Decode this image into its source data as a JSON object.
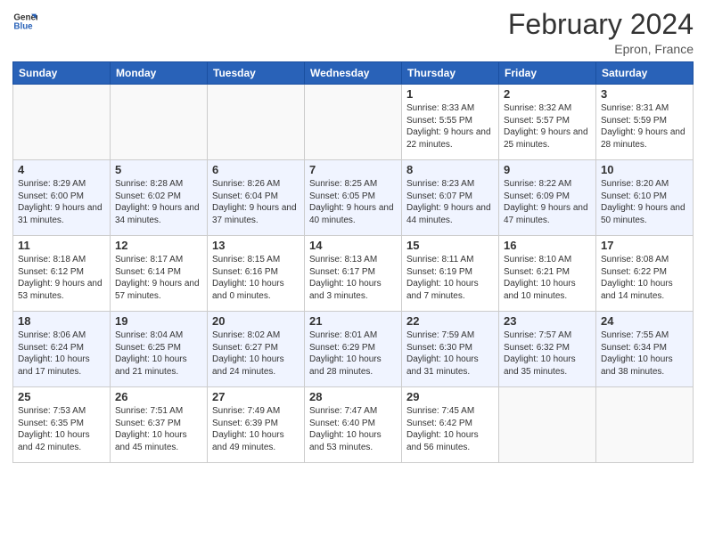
{
  "header": {
    "logo_line1": "General",
    "logo_line2": "Blue",
    "title": "February 2024",
    "subtitle": "Epron, France"
  },
  "days_of_week": [
    "Sunday",
    "Monday",
    "Tuesday",
    "Wednesday",
    "Thursday",
    "Friday",
    "Saturday"
  ],
  "weeks": [
    {
      "alt": false,
      "days": [
        {
          "num": "",
          "info": ""
        },
        {
          "num": "",
          "info": ""
        },
        {
          "num": "",
          "info": ""
        },
        {
          "num": "",
          "info": ""
        },
        {
          "num": "1",
          "info": "Sunrise: 8:33 AM\nSunset: 5:55 PM\nDaylight: 9 hours and 22 minutes."
        },
        {
          "num": "2",
          "info": "Sunrise: 8:32 AM\nSunset: 5:57 PM\nDaylight: 9 hours and 25 minutes."
        },
        {
          "num": "3",
          "info": "Sunrise: 8:31 AM\nSunset: 5:59 PM\nDaylight: 9 hours and 28 minutes."
        }
      ]
    },
    {
      "alt": true,
      "days": [
        {
          "num": "4",
          "info": "Sunrise: 8:29 AM\nSunset: 6:00 PM\nDaylight: 9 hours and 31 minutes."
        },
        {
          "num": "5",
          "info": "Sunrise: 8:28 AM\nSunset: 6:02 PM\nDaylight: 9 hours and 34 minutes."
        },
        {
          "num": "6",
          "info": "Sunrise: 8:26 AM\nSunset: 6:04 PM\nDaylight: 9 hours and 37 minutes."
        },
        {
          "num": "7",
          "info": "Sunrise: 8:25 AM\nSunset: 6:05 PM\nDaylight: 9 hours and 40 minutes."
        },
        {
          "num": "8",
          "info": "Sunrise: 8:23 AM\nSunset: 6:07 PM\nDaylight: 9 hours and 44 minutes."
        },
        {
          "num": "9",
          "info": "Sunrise: 8:22 AM\nSunset: 6:09 PM\nDaylight: 9 hours and 47 minutes."
        },
        {
          "num": "10",
          "info": "Sunrise: 8:20 AM\nSunset: 6:10 PM\nDaylight: 9 hours and 50 minutes."
        }
      ]
    },
    {
      "alt": false,
      "days": [
        {
          "num": "11",
          "info": "Sunrise: 8:18 AM\nSunset: 6:12 PM\nDaylight: 9 hours and 53 minutes."
        },
        {
          "num": "12",
          "info": "Sunrise: 8:17 AM\nSunset: 6:14 PM\nDaylight: 9 hours and 57 minutes."
        },
        {
          "num": "13",
          "info": "Sunrise: 8:15 AM\nSunset: 6:16 PM\nDaylight: 10 hours and 0 minutes."
        },
        {
          "num": "14",
          "info": "Sunrise: 8:13 AM\nSunset: 6:17 PM\nDaylight: 10 hours and 3 minutes."
        },
        {
          "num": "15",
          "info": "Sunrise: 8:11 AM\nSunset: 6:19 PM\nDaylight: 10 hours and 7 minutes."
        },
        {
          "num": "16",
          "info": "Sunrise: 8:10 AM\nSunset: 6:21 PM\nDaylight: 10 hours and 10 minutes."
        },
        {
          "num": "17",
          "info": "Sunrise: 8:08 AM\nSunset: 6:22 PM\nDaylight: 10 hours and 14 minutes."
        }
      ]
    },
    {
      "alt": true,
      "days": [
        {
          "num": "18",
          "info": "Sunrise: 8:06 AM\nSunset: 6:24 PM\nDaylight: 10 hours and 17 minutes."
        },
        {
          "num": "19",
          "info": "Sunrise: 8:04 AM\nSunset: 6:25 PM\nDaylight: 10 hours and 21 minutes."
        },
        {
          "num": "20",
          "info": "Sunrise: 8:02 AM\nSunset: 6:27 PM\nDaylight: 10 hours and 24 minutes."
        },
        {
          "num": "21",
          "info": "Sunrise: 8:01 AM\nSunset: 6:29 PM\nDaylight: 10 hours and 28 minutes."
        },
        {
          "num": "22",
          "info": "Sunrise: 7:59 AM\nSunset: 6:30 PM\nDaylight: 10 hours and 31 minutes."
        },
        {
          "num": "23",
          "info": "Sunrise: 7:57 AM\nSunset: 6:32 PM\nDaylight: 10 hours and 35 minutes."
        },
        {
          "num": "24",
          "info": "Sunrise: 7:55 AM\nSunset: 6:34 PM\nDaylight: 10 hours and 38 minutes."
        }
      ]
    },
    {
      "alt": false,
      "days": [
        {
          "num": "25",
          "info": "Sunrise: 7:53 AM\nSunset: 6:35 PM\nDaylight: 10 hours and 42 minutes."
        },
        {
          "num": "26",
          "info": "Sunrise: 7:51 AM\nSunset: 6:37 PM\nDaylight: 10 hours and 45 minutes."
        },
        {
          "num": "27",
          "info": "Sunrise: 7:49 AM\nSunset: 6:39 PM\nDaylight: 10 hours and 49 minutes."
        },
        {
          "num": "28",
          "info": "Sunrise: 7:47 AM\nSunset: 6:40 PM\nDaylight: 10 hours and 53 minutes."
        },
        {
          "num": "29",
          "info": "Sunrise: 7:45 AM\nSunset: 6:42 PM\nDaylight: 10 hours and 56 minutes."
        },
        {
          "num": "",
          "info": ""
        },
        {
          "num": "",
          "info": ""
        }
      ]
    }
  ]
}
